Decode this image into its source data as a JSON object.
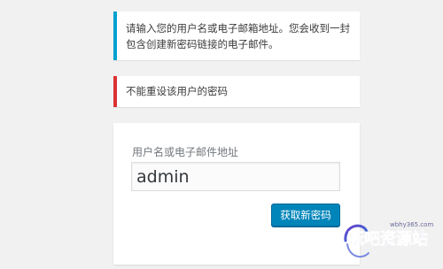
{
  "notices": {
    "info_line1": "请输入您的用户名或电子邮箱地址。您会收到一封",
    "info_line2": "包含创建新密码链接的电子邮件。",
    "error": "不能重设该用户的密码",
    "info_color": "#00a0d2",
    "error_color": "#dc3232"
  },
  "form": {
    "label": "用户名或电子邮件地址",
    "username_value": "admin",
    "submit_label": "获取新密码",
    "button_color": "#0085ba"
  },
  "watermark": {
    "url": "wbhy365.com",
    "text": "玩吧资源站"
  }
}
